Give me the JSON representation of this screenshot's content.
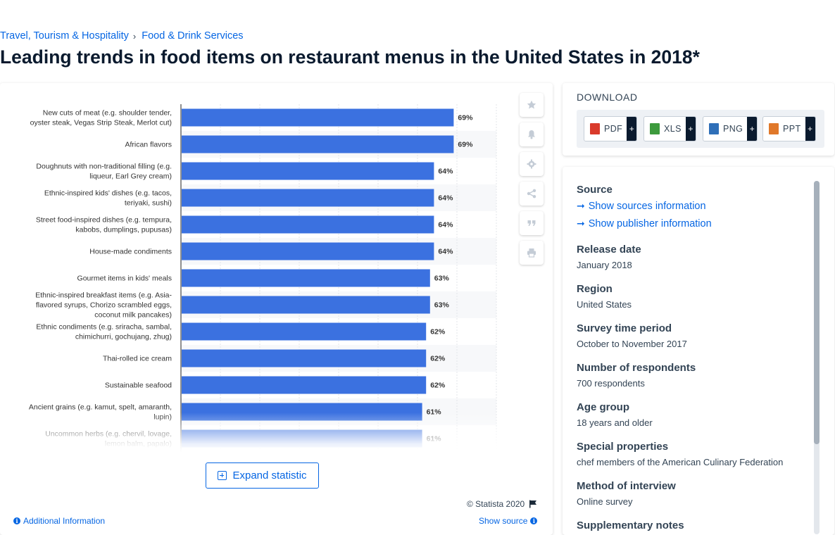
{
  "breadcrumb": {
    "item1": "Travel, Tourism & Hospitality",
    "separator": "›",
    "item2": "Food & Drink Services"
  },
  "title": "Leading trends in food items on restaurant menus in the United States in 2018*",
  "chart_data": {
    "type": "bar",
    "orientation": "horizontal",
    "value_format": "{v}%",
    "xlim": [
      0,
      80
    ],
    "categories": [
      [
        "New cuts of meat (e.g. shoulder tender,",
        "oyster steak, Vegas Strip Steak, Merlot cut)"
      ],
      [
        "African flavors"
      ],
      [
        "Doughnuts with non-traditional filling (e.g.",
        "liqueur, Earl Grey cream)"
      ],
      [
        "Ethnic-inspired kids' dishes (e.g. tacos,",
        "teriyaki, sushi)"
      ],
      [
        "Street food-inspired dishes (e.g. tempura,",
        "kabobs, dumplings, pupusas)"
      ],
      [
        "House-made condiments"
      ],
      [
        "Gourmet items in kids' meals"
      ],
      [
        "Ethnic-inspired breakfast items (e.g. Asia-",
        "flavored syrups, Chorizo scrambled eggs,",
        "coconut milk pancakes)"
      ],
      [
        "Ethnic condiments (e.g. sriracha, sambal,",
        "chimichurri, gochujang, zhug)"
      ],
      [
        "Thai-rolled ice cream"
      ],
      [
        "Sustainable seafood"
      ],
      [
        "Ancient grains (e.g. kamut, spelt, amaranth,",
        "lupin)"
      ],
      [
        "Uncommon herbs (e.g. chervil, lovage,",
        "lemon balm, papalo)"
      ]
    ],
    "values": [
      69,
      69,
      64,
      64,
      64,
      64,
      63,
      63,
      62,
      62,
      62,
      61,
      61
    ],
    "bar_color": "#3b71e0",
    "grid": true
  },
  "toolbar": {
    "icons": [
      "star-icon",
      "bell-icon",
      "gear-icon",
      "share-icon",
      "quote-icon",
      "print-icon"
    ]
  },
  "expand_label": "Expand statistic",
  "copyright": "© Statista 2020",
  "additional_info": "Additional Information",
  "show_source": "Show source",
  "download": {
    "title": "DOWNLOAD",
    "buttons": [
      {
        "label": "PDF",
        "color": "#d93a2b"
      },
      {
        "label": "XLS",
        "color": "#3d9a3d"
      },
      {
        "label": "PNG",
        "color": "#2f6fb8"
      },
      {
        "label": "PPT",
        "color": "#e0782a"
      }
    ],
    "plus": "+"
  },
  "info": {
    "source_label": "Source",
    "show_sources": "Show sources information",
    "show_publisher": "Show publisher information",
    "release_label": "Release date",
    "release_value": "January 2018",
    "region_label": "Region",
    "region_value": "United States",
    "period_label": "Survey time period",
    "period_value": "October to November 2017",
    "respondents_label": "Number of respondents",
    "respondents_value": "700 respondents",
    "age_label": "Age group",
    "age_value": "18 years and older",
    "special_label": "Special properties",
    "special_value": "chef members of the American Culinary Federation",
    "method_label": "Method of interview",
    "method_value": "Online survey",
    "notes_label": "Supplementary notes"
  }
}
